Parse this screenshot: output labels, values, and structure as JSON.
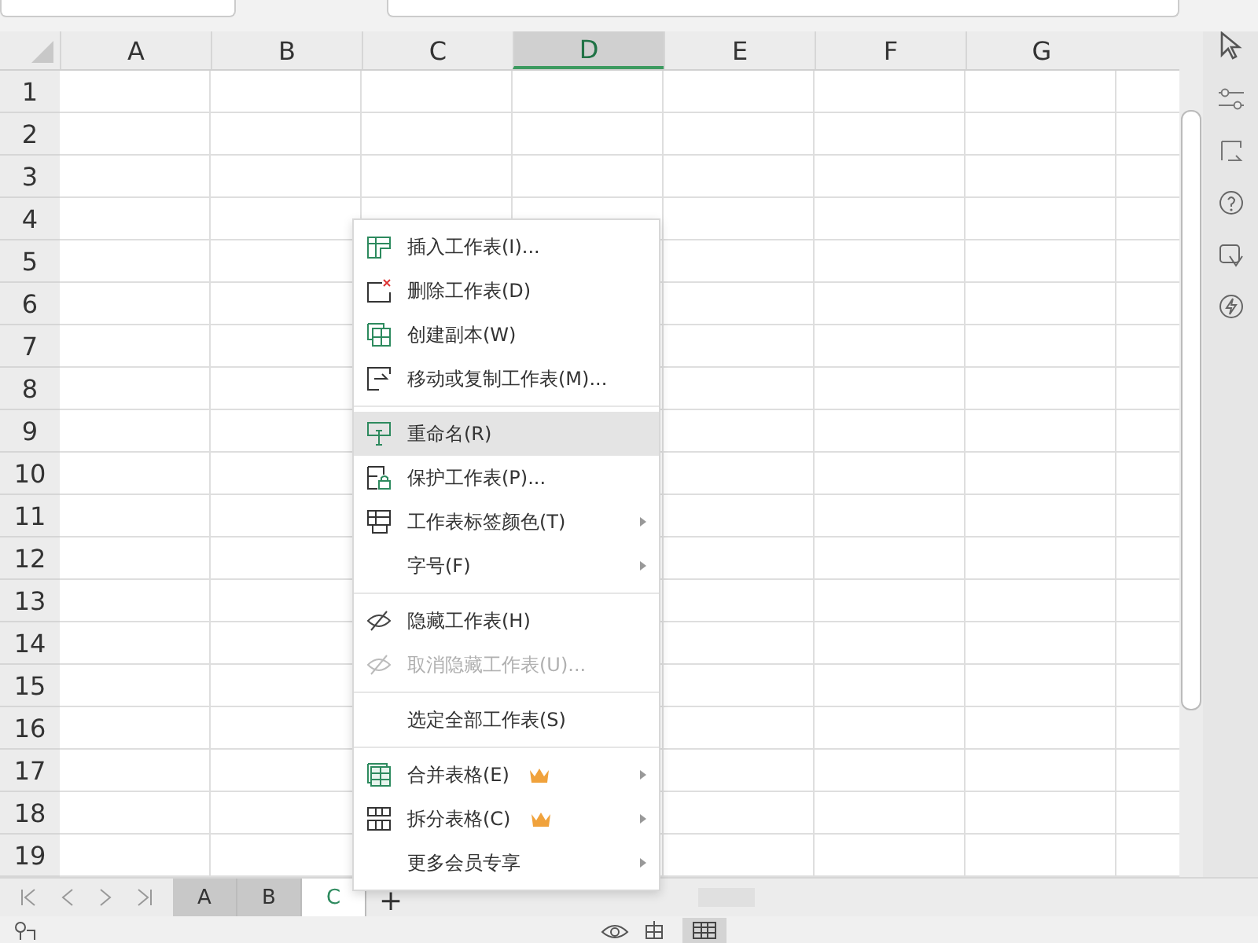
{
  "columns": [
    {
      "label": "A",
      "selected": false
    },
    {
      "label": "B",
      "selected": false
    },
    {
      "label": "C",
      "selected": false
    },
    {
      "label": "D",
      "selected": true
    },
    {
      "label": "E",
      "selected": false
    },
    {
      "label": "F",
      "selected": false
    },
    {
      "label": "G",
      "selected": false
    }
  ],
  "rows": [
    "1",
    "2",
    "3",
    "4",
    "5",
    "6",
    "7",
    "8",
    "9",
    "10",
    "11",
    "12",
    "13",
    "14",
    "15",
    "16",
    "17",
    "18",
    "19"
  ],
  "context_menu": {
    "groups": [
      [
        {
          "label": "插入工作表(I)...",
          "selected": false,
          "disabled": false,
          "submenu": false,
          "premium": false
        },
        {
          "label": "删除工作表(D)",
          "selected": false,
          "disabled": false,
          "submenu": false,
          "premium": false
        },
        {
          "label": "创建副本(W)",
          "selected": false,
          "disabled": false,
          "submenu": false,
          "premium": false
        },
        {
          "label": "移动或复制工作表(M)...",
          "selected": false,
          "disabled": false,
          "submenu": false,
          "premium": false
        }
      ],
      [
        {
          "label": "重命名(R)",
          "selected": true,
          "disabled": false,
          "submenu": false,
          "premium": false
        },
        {
          "label": "保护工作表(P)...",
          "selected": false,
          "disabled": false,
          "submenu": false,
          "premium": false
        },
        {
          "label": "工作表标签颜色(T)",
          "selected": false,
          "disabled": false,
          "submenu": true,
          "premium": false
        },
        {
          "label": "字号(F)",
          "selected": false,
          "disabled": false,
          "submenu": true,
          "premium": false
        }
      ],
      [
        {
          "label": "隐藏工作表(H)",
          "selected": false,
          "disabled": false,
          "submenu": false,
          "premium": false
        },
        {
          "label": "取消隐藏工作表(U)...",
          "selected": false,
          "disabled": true,
          "submenu": false,
          "premium": false
        }
      ],
      [
        {
          "label": "选定全部工作表(S)",
          "selected": false,
          "disabled": false,
          "submenu": false,
          "premium": false
        }
      ],
      [
        {
          "label": "合并表格(E)",
          "selected": false,
          "disabled": false,
          "submenu": true,
          "premium": true
        },
        {
          "label": "拆分表格(C)",
          "selected": false,
          "disabled": false,
          "submenu": true,
          "premium": true
        },
        {
          "label": "更多会员专享",
          "selected": false,
          "disabled": false,
          "submenu": true,
          "premium": false
        }
      ]
    ]
  },
  "sheet_tabs": [
    {
      "label": "A",
      "selected": false
    },
    {
      "label": "B",
      "selected": false
    },
    {
      "label": "C",
      "selected": true
    }
  ],
  "add_sheet": "+"
}
